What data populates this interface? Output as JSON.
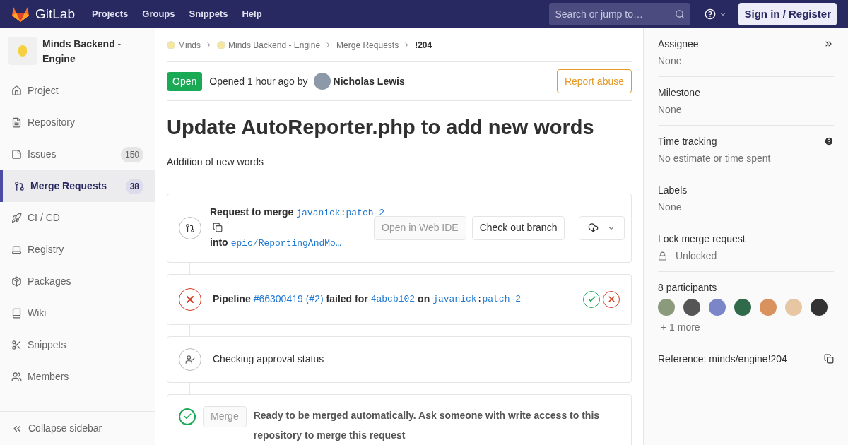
{
  "topbar": {
    "brand": "GitLab",
    "nav": [
      "Projects",
      "Groups",
      "Snippets",
      "Help"
    ],
    "search": {
      "placeholder": "Search or jump to…"
    },
    "sign_in": "Sign in / Register"
  },
  "sidebar": {
    "project": "Minds Backend - Engine",
    "items": [
      {
        "label": "Project",
        "selected": false
      },
      {
        "label": "Repository",
        "selected": false
      },
      {
        "label": "Issues",
        "count": "150",
        "selected": false
      },
      {
        "label": "Merge Requests",
        "count": "38",
        "selected": true
      },
      {
        "label": "CI / CD",
        "selected": false
      },
      {
        "label": "Registry",
        "selected": false
      },
      {
        "label": "Packages",
        "selected": false
      },
      {
        "label": "Wiki",
        "selected": false
      },
      {
        "label": "Snippets",
        "selected": false
      },
      {
        "label": "Members",
        "selected": false
      }
    ],
    "collapse": "Collapse sidebar"
  },
  "breadcrumbs": [
    {
      "label": "Minds",
      "avatar": true
    },
    {
      "label": "Minds Backend - Engine",
      "avatar": true
    },
    {
      "label": "Merge Requests",
      "avatar": false
    },
    {
      "label": "!204",
      "avatar": false,
      "current": true
    }
  ],
  "header": {
    "status": "Open",
    "opened": "Opened 1 hour ago by",
    "author": "Nicholas Lewis",
    "report": "Report abuse"
  },
  "title": "Update AutoReporter.php to add new words",
  "description": "Addition of new words",
  "merge_info": {
    "segments": [
      {
        "kind": "bold",
        "text": "Request to merge"
      },
      {
        "kind": "code",
        "text": "javanick"
      },
      {
        "kind": "plain",
        "text": ":"
      },
      {
        "kind": "code",
        "text": "patch-2"
      },
      {
        "kind": "copy"
      },
      {
        "kind": "bold",
        "text": "into"
      },
      {
        "kind": "code",
        "text": "epic/ReportingAndMo…"
      }
    ],
    "web_ide": "Open in Web IDE",
    "checkout": "Check out branch"
  },
  "pipeline": {
    "segments": [
      {
        "kind": "bold",
        "text": "Pipeline"
      },
      {
        "kind": "link",
        "text": "#66300419 (#2)"
      },
      {
        "kind": "bold",
        "text": "failed for"
      },
      {
        "kind": "code",
        "text": "4abcb102"
      },
      {
        "kind": "bold",
        "text": "on"
      },
      {
        "kind": "code",
        "text": "javanick"
      },
      {
        "kind": "plain",
        "text": ":"
      },
      {
        "kind": "code",
        "text": "patch-2"
      }
    ],
    "stages": [
      {
        "passed": true
      },
      {
        "passed": false
      }
    ]
  },
  "approval": "Checking approval status",
  "merge": {
    "button": "Merge",
    "message": "Ready to be merged automatically. Ask someone with write access to this repository to merge this request"
  },
  "right_sidebar": {
    "sections": [
      {
        "kind": "plain",
        "title": "Assignee",
        "value": "None",
        "collapse": true
      },
      {
        "kind": "plain",
        "title": "Milestone",
        "value": "None"
      },
      {
        "kind": "help",
        "title": "Time tracking",
        "value": "No estimate or time spent"
      },
      {
        "kind": "plain",
        "title": "Labels",
        "value": "None"
      },
      {
        "kind": "lock",
        "title": "Lock merge request",
        "value": "Unlocked"
      },
      {
        "kind": "participants",
        "title": "8 participants",
        "value": "+ 1 more"
      },
      {
        "kind": "reference",
        "title": "Reference: minds/engine!204"
      }
    ]
  }
}
